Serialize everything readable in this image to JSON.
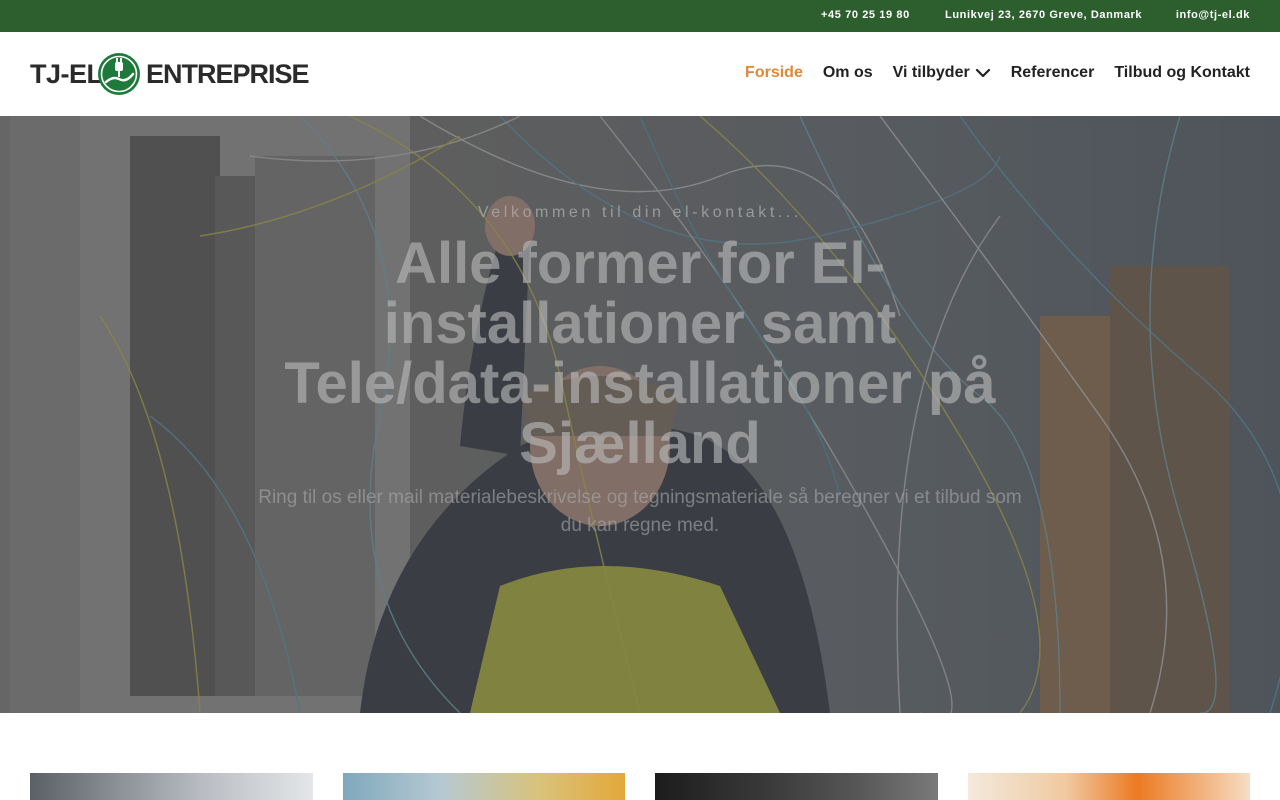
{
  "topbar": {
    "phone": "+45 70 25 19 80",
    "address": "Lunikvej 23, 2670 Greve, Danmark",
    "email": "info@tj-el.dk"
  },
  "logo": {
    "text_left": "TJ-EL",
    "text_right": "ENTREPRISE",
    "icon": "plug-emblem-icon"
  },
  "nav": {
    "items": [
      {
        "label": "Forside",
        "active": true
      },
      {
        "label": "Om os"
      },
      {
        "label": "Vi tilbyder",
        "has_dropdown": true
      },
      {
        "label": "Referencer"
      },
      {
        "label": "Tilbud og Kontakt"
      }
    ]
  },
  "hero": {
    "eyebrow": "Velkommen til din el-kontakt...",
    "headline": "Alle former for El-installationer samt Tele/data-installationer på Sjælland",
    "subtitle": "Ring til os eller mail materialebeskrivelse og tegningsmateriale så beregner vi et tilbud som du kan regne med."
  },
  "colors": {
    "topbar_bg": "#2c5e2e",
    "accent": "#e0883a",
    "nav_text": "#222222",
    "logo_green": "#1e7a3a"
  }
}
